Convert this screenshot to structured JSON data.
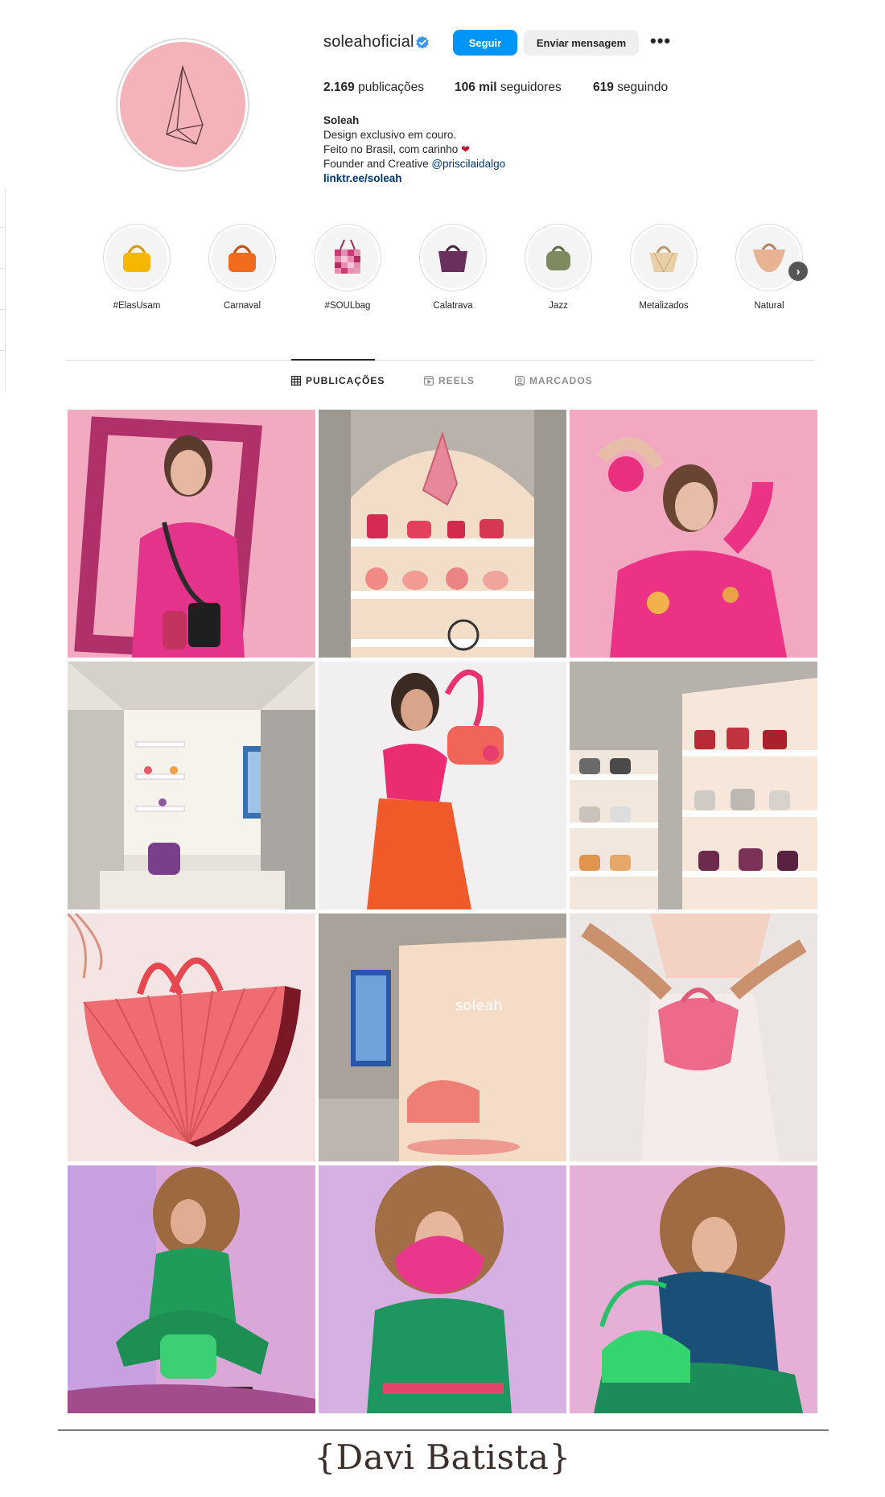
{
  "profile": {
    "username": "soleahoficial",
    "verified_icon": "verified-badge-icon",
    "follow_label": "Seguir",
    "message_label": "Enviar mensagem",
    "more_label": "•••",
    "stats": {
      "posts_value": "2.169",
      "posts_label": "publicações",
      "followers_value": "106 mil",
      "followers_label": "seguidores",
      "following_value": "619",
      "following_label": "seguindo"
    },
    "bio": {
      "name": "Soleah",
      "line1": "Design exclusivo em couro.",
      "line2": "Feito no Brasil, com carinho",
      "line3_prefix": "Founder and Creative",
      "line3_mention": "@priscilaidalgo",
      "link": "linktr.ee/soleah"
    },
    "avatar_color": "#f3b3b8"
  },
  "highlights": [
    {
      "label": "#ElasUsam",
      "bag_color": "#f5b700"
    },
    {
      "label": "Carnaval",
      "bag_color": "#f26a1b"
    },
    {
      "label": "#SOULbag",
      "bag_color": "#d94e86"
    },
    {
      "label": "Calatrava",
      "bag_color": "#6b2f5e"
    },
    {
      "label": "Jazz",
      "bag_color": "#7f8a5e"
    },
    {
      "label": "Metalizados",
      "bag_color": "#e8cfa8"
    },
    {
      "label": "Natural",
      "bag_color": "#e8b392"
    }
  ],
  "tabs": [
    {
      "label": "PUBLICAÇÕES",
      "icon": "grid-icon",
      "active": true
    },
    {
      "label": "REELS",
      "icon": "reels-icon",
      "active": false
    },
    {
      "label": "MARCADOS",
      "icon": "tagged-icon",
      "active": false
    }
  ],
  "posts": [
    {
      "subject": "model-pink-frame",
      "bg": "#f0a9be"
    },
    {
      "subject": "store-arch-shelves",
      "bg": "#e9d6c4"
    },
    {
      "subject": "model-pink-hoodie",
      "bg": "#f29ab8"
    },
    {
      "subject": "store-interior",
      "bg": "#d9d4cc"
    },
    {
      "subject": "model-orange-bag",
      "bg": "#f0eeee"
    },
    {
      "subject": "store-shelves-bags",
      "bg": "#d6cfc6"
    },
    {
      "subject": "red-fan-bag",
      "bg": "#f2dcdc"
    },
    {
      "subject": "store-lounge",
      "bg": "#cfc8c0"
    },
    {
      "subject": "pink-bag-hands",
      "bg": "#e9e4e2"
    },
    {
      "subject": "model-green-1",
      "bg": "#d9a3d6"
    },
    {
      "subject": "model-green-2",
      "bg": "#d7a9dc"
    },
    {
      "subject": "model-green-3",
      "bg": "#e2a7cf"
    }
  ],
  "footer": {
    "signature": "{Davi Batista}"
  }
}
